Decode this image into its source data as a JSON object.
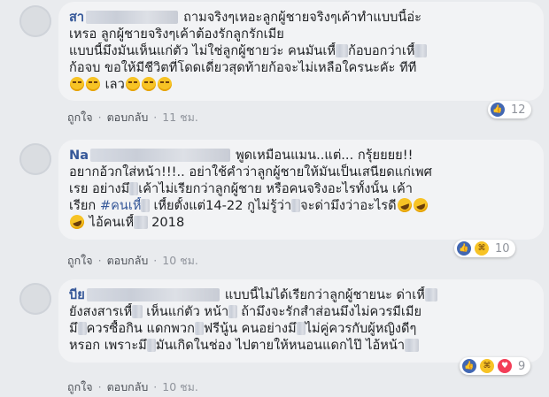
{
  "comments": [
    {
      "lines": [
        {
          "name": "สา",
          "t1": "ถามจริงๆเหอะลูกผู้ชายจริงๆเค้าทำแบบนี้อ่ะ"
        },
        {
          "t1": "เหรอ ลูกผู้ชายจริงๆเค้าต้องรักลูกรักเมีย"
        },
        {
          "t1": "แบบนี้มึงมันเห็นแก่ตัว ไม่ใช่ลูกผู้ชายว่ะ คนมันเหี้",
          "t2": "ก้อบอกว่าเหี้"
        },
        {
          "t1": "ก้อจบ ขอให้มีชีวิตที่โดดเดี่ยวสุดท้ายก้อจะไม่เหลือใครนะคัะ ทีที"
        },
        {
          "t1": "เลว"
        }
      ],
      "actions": {
        "like": "ถูกใจ",
        "reply": "ตอบกลับ",
        "time": "11 ชม."
      },
      "reactions": {
        "count": "12"
      }
    },
    {
      "lines": [
        {
          "name": "Na",
          "t1": "พูดเหมือนแมน..แต่... กรุ้ยยยย!!"
        },
        {
          "t1": "อยากอ้วกใส่หน้า!!!..  อย่าใช้คำว่าลูกผู้ชายให้มันเป็นเสนียดแก่เพศ"
        },
        {
          "t1": "เรย อย่างมึ",
          "t2": "เค้าไม่เรียกว่าลูกผู้ชาย หรือคนจริงอะไรทั้งนั้น เค้า"
        },
        {
          "t1": "เรียก",
          "hashtag": "#คนเหี้",
          "t2": "เหี้ยตั้งแต่14-22 กูไม่รู้ว่า",
          "t3": "จะด่ามึงว่าอะไรดี"
        },
        {
          "t1": "ไอ้คนเหี้",
          "t2": "2018"
        }
      ],
      "actions": {
        "like": "ถูกใจ",
        "reply": "ตอบกลับ",
        "time": "10 ชม."
      },
      "reactions": {
        "count": "10"
      }
    },
    {
      "lines": [
        {
          "name": "บีย",
          "t1": "แบบนี้ไม่ได้เรียกว่าลูกผู้ชายนะ ด่าเหี้"
        },
        {
          "t1": "ยังสงสารเหี้",
          "t2": "เห็นแก่ตัว หน้า",
          "t3": "ถ้ามึงจะรักสำส่อนมึงไม่ควรมีเมีย"
        },
        {
          "t1": "มึ",
          "t2": "ควรซื้อกิน แดกพวก",
          "t3": "ฟรีนู้น คนอย่างมึ",
          "t4": "ไม่คู่ควรกับผู้หญิงดีๆ"
        },
        {
          "t1": "หรอก เพราะมึ",
          "t2": "มันเกิดในช่อง ไปตายให้หนอนแดกไป๊ ไอ้หน้า"
        }
      ],
      "actions": {
        "like": "ถูกใจ",
        "reply": "ตอบกลับ",
        "time": "10 ชม."
      },
      "reactions": {
        "count": "9"
      }
    }
  ],
  "icons": {
    "like": "thumbs-up-icon",
    "haha": "haha-emoji-icon",
    "love": "heart-icon",
    "smirk": "smirk-emoji-icon",
    "laugh": "rofl-emoji-icon"
  },
  "colors": {
    "name": "#365899",
    "bubble": "#f2f3f5",
    "like": "#4267b2",
    "love": "#f33e58",
    "background": "#e9ebee"
  }
}
